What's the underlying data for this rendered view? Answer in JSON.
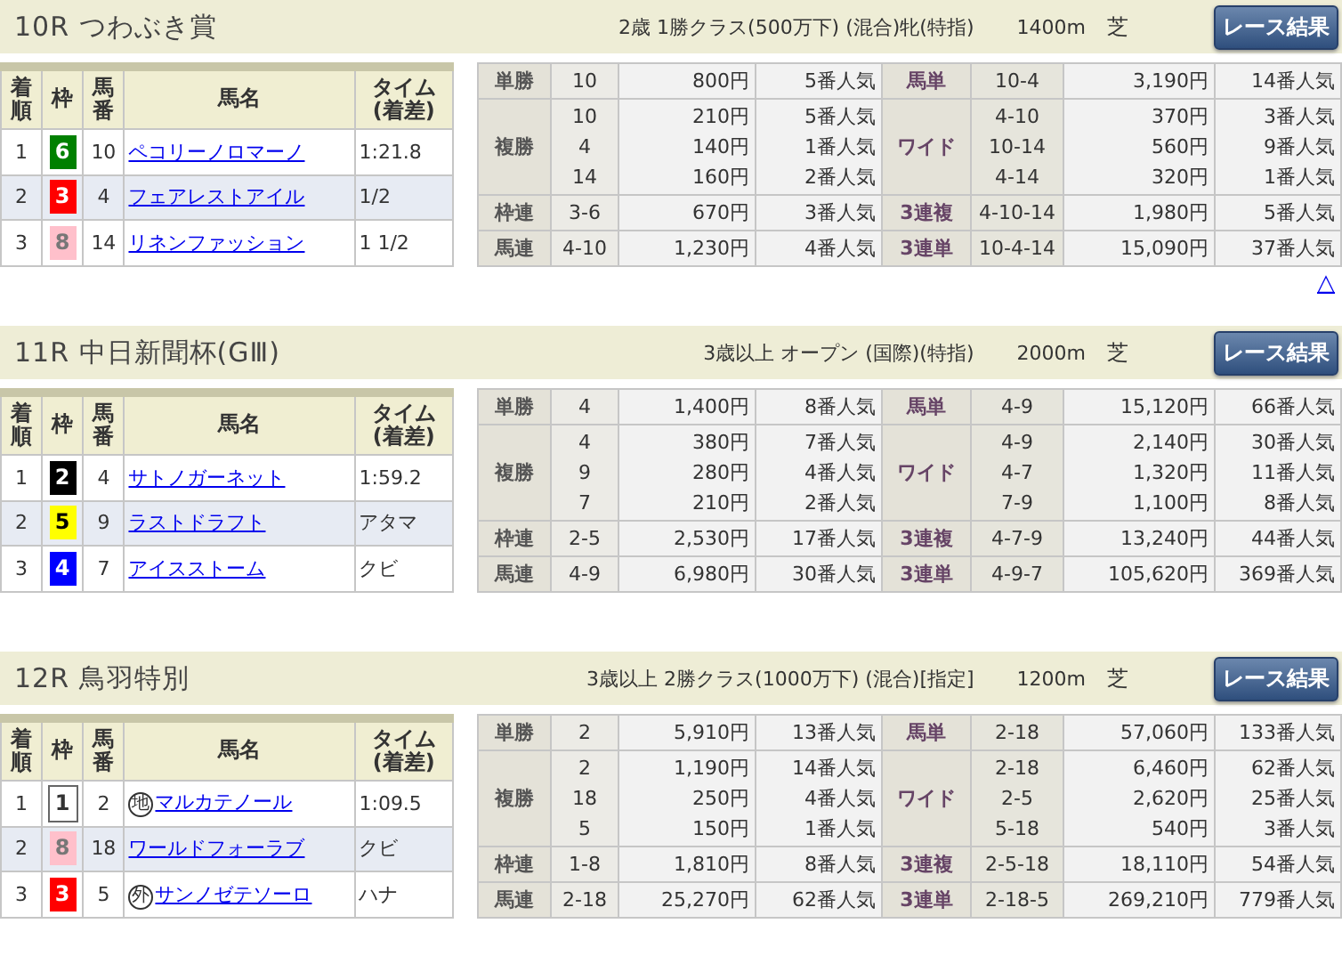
{
  "races": [
    {
      "title": "10R つわぶき賞",
      "conditions": "2歳 1勝クラス(500万下) (混合)牝(特指)",
      "distance": "1400m",
      "surface": "芝",
      "button": "レース結果",
      "columns": [
        "着順",
        "枠",
        "馬番",
        "馬名",
        "タイム (着差)"
      ],
      "rows": [
        {
          "place": "1",
          "bracket": "6",
          "color": "#008000",
          "number": "10",
          "horse": "ペコリーノロマーノ",
          "time": "1:21.8"
        },
        {
          "place": "2",
          "bracket": "3",
          "color": "#ff0000",
          "number": "4",
          "horse": "フェアレストアイル",
          "time": "1/2"
        },
        {
          "place": "3",
          "bracket": "8",
          "color": "#ffc0cb",
          "number": "14",
          "horse": "リネンファッション",
          "time": "1 1/2"
        }
      ],
      "payouts": [
        {
          "left": {
            "bet": "単勝",
            "entries": [
              {
                "combo": "10",
                "amount": "800円",
                "popularity": "5番人気"
              }
            ]
          },
          "right": {
            "bet": "馬単",
            "entries": [
              {
                "combo": "10-4",
                "amount": "3,190円",
                "popularity": "14番人気"
              }
            ]
          }
        },
        {
          "left": {
            "bet": "複勝",
            "entries": [
              {
                "combo": "10",
                "amount": "210円",
                "popularity": "5番人気"
              },
              {
                "combo": "4",
                "amount": "140円",
                "popularity": "1番人気"
              },
              {
                "combo": "14",
                "amount": "160円",
                "popularity": "2番人気"
              }
            ]
          },
          "right": {
            "bet": "ワイド",
            "entries": [
              {
                "combo": "4-10",
                "amount": "370円",
                "popularity": "3番人気"
              },
              {
                "combo": "10-14",
                "amount": "560円",
                "popularity": "9番人気"
              },
              {
                "combo": "4-14",
                "amount": "320円",
                "popularity": "1番人気"
              }
            ]
          }
        },
        {
          "left": {
            "bet": "枠連",
            "entries": [
              {
                "combo": "3-6",
                "amount": "670円",
                "popularity": "3番人気"
              }
            ]
          },
          "right": {
            "bet": "3連複",
            "entries": [
              {
                "combo": "4-10-14",
                "amount": "1,980円",
                "popularity": "5番人気"
              }
            ]
          }
        },
        {
          "left": {
            "bet": "馬連",
            "entries": [
              {
                "combo": "4-10",
                "amount": "1,230円",
                "popularity": "4番人気"
              }
            ]
          },
          "right": {
            "bet": "3連単",
            "entries": [
              {
                "combo": "10-4-14",
                "amount": "15,090円",
                "popularity": "37番人気"
              }
            ]
          }
        }
      ],
      "top_link": "△"
    },
    {
      "title": "11R 中日新聞杯(GⅢ)",
      "conditions": "3歳以上 オープン (国際)(特指)",
      "distance": "2000m",
      "surface": "芝",
      "button": "レース結果",
      "columns": [
        "着順",
        "枠",
        "馬番",
        "馬名",
        "タイム (着差)"
      ],
      "rows": [
        {
          "place": "1",
          "bracket": "2",
          "color": "#000000",
          "number": "4",
          "horse": "サトノガーネット",
          "time": "1:59.2"
        },
        {
          "place": "2",
          "bracket": "5",
          "color": "#ffff00",
          "number": "9",
          "horse": "ラストドラフト",
          "time": "アタマ"
        },
        {
          "place": "3",
          "bracket": "4",
          "color": "#0000ff",
          "number": "7",
          "horse": "アイスストーム",
          "time": "クビ"
        }
      ],
      "payouts": [
        {
          "left": {
            "bet": "単勝",
            "entries": [
              {
                "combo": "4",
                "amount": "1,400円",
                "popularity": "8番人気"
              }
            ]
          },
          "right": {
            "bet": "馬単",
            "entries": [
              {
                "combo": "4-9",
                "amount": "15,120円",
                "popularity": "66番人気"
              }
            ]
          }
        },
        {
          "left": {
            "bet": "複勝",
            "entries": [
              {
                "combo": "4",
                "amount": "380円",
                "popularity": "7番人気"
              },
              {
                "combo": "9",
                "amount": "280円",
                "popularity": "4番人気"
              },
              {
                "combo": "7",
                "amount": "210円",
                "popularity": "2番人気"
              }
            ]
          },
          "right": {
            "bet": "ワイド",
            "entries": [
              {
                "combo": "4-9",
                "amount": "2,140円",
                "popularity": "30番人気"
              },
              {
                "combo": "4-7",
                "amount": "1,320円",
                "popularity": "11番人気"
              },
              {
                "combo": "7-9",
                "amount": "1,100円",
                "popularity": "8番人気"
              }
            ]
          }
        },
        {
          "left": {
            "bet": "枠連",
            "entries": [
              {
                "combo": "2-5",
                "amount": "2,530円",
                "popularity": "17番人気"
              }
            ]
          },
          "right": {
            "bet": "3連複",
            "entries": [
              {
                "combo": "4-7-9",
                "amount": "13,240円",
                "popularity": "44番人気"
              }
            ]
          }
        },
        {
          "left": {
            "bet": "馬連",
            "entries": [
              {
                "combo": "4-9",
                "amount": "6,980円",
                "popularity": "30番人気"
              }
            ]
          },
          "right": {
            "bet": "3連単",
            "entries": [
              {
                "combo": "4-9-7",
                "amount": "105,620円",
                "popularity": "369番人気"
              }
            ]
          }
        }
      ]
    },
    {
      "title": "12R 鳥羽特別",
      "conditions": "3歳以上 2勝クラス(1000万下) (混合)[指定]",
      "distance": "1200m",
      "surface": "芝",
      "button": "レース結果",
      "columns": [
        "着順",
        "枠",
        "馬番",
        "馬名",
        "タイム (着差)"
      ],
      "rows": [
        {
          "place": "1",
          "bracket": "1",
          "color": "#ffffff",
          "number": "2",
          "mark": "地",
          "horse": "マルカテノール",
          "time": "1:09.5"
        },
        {
          "place": "2",
          "bracket": "8",
          "color": "#ffc0cb",
          "number": "18",
          "horse": "ワールドフォーラブ",
          "time": "クビ"
        },
        {
          "place": "3",
          "bracket": "3",
          "color": "#ff0000",
          "number": "5",
          "mark": "外",
          "horse": "サンノゼテソーロ",
          "time": "ハナ"
        }
      ],
      "payouts": [
        {
          "left": {
            "bet": "単勝",
            "entries": [
              {
                "combo": "2",
                "amount": "5,910円",
                "popularity": "13番人気"
              }
            ]
          },
          "right": {
            "bet": "馬単",
            "entries": [
              {
                "combo": "2-18",
                "amount": "57,060円",
                "popularity": "133番人気"
              }
            ]
          }
        },
        {
          "left": {
            "bet": "複勝",
            "entries": [
              {
                "combo": "2",
                "amount": "1,190円",
                "popularity": "14番人気"
              },
              {
                "combo": "18",
                "amount": "250円",
                "popularity": "4番人気"
              },
              {
                "combo": "5",
                "amount": "150円",
                "popularity": "1番人気"
              }
            ]
          },
          "right": {
            "bet": "ワイド",
            "entries": [
              {
                "combo": "2-18",
                "amount": "6,460円",
                "popularity": "62番人気"
              },
              {
                "combo": "2-5",
                "amount": "2,620円",
                "popularity": "25番人気"
              },
              {
                "combo": "5-18",
                "amount": "540円",
                "popularity": "3番人気"
              }
            ]
          }
        },
        {
          "left": {
            "bet": "枠連",
            "entries": [
              {
                "combo": "1-8",
                "amount": "1,810円",
                "popularity": "8番人気"
              }
            ]
          },
          "right": {
            "bet": "3連複",
            "entries": [
              {
                "combo": "2-5-18",
                "amount": "18,110円",
                "popularity": "54番人気"
              }
            ]
          }
        },
        {
          "left": {
            "bet": "馬連",
            "entries": [
              {
                "combo": "2-18",
                "amount": "25,270円",
                "popularity": "62番人気"
              }
            ]
          },
          "right": {
            "bet": "3連単",
            "entries": [
              {
                "combo": "2-18-5",
                "amount": "269,210円",
                "popularity": "779番人気"
              }
            ]
          }
        }
      ]
    }
  ]
}
